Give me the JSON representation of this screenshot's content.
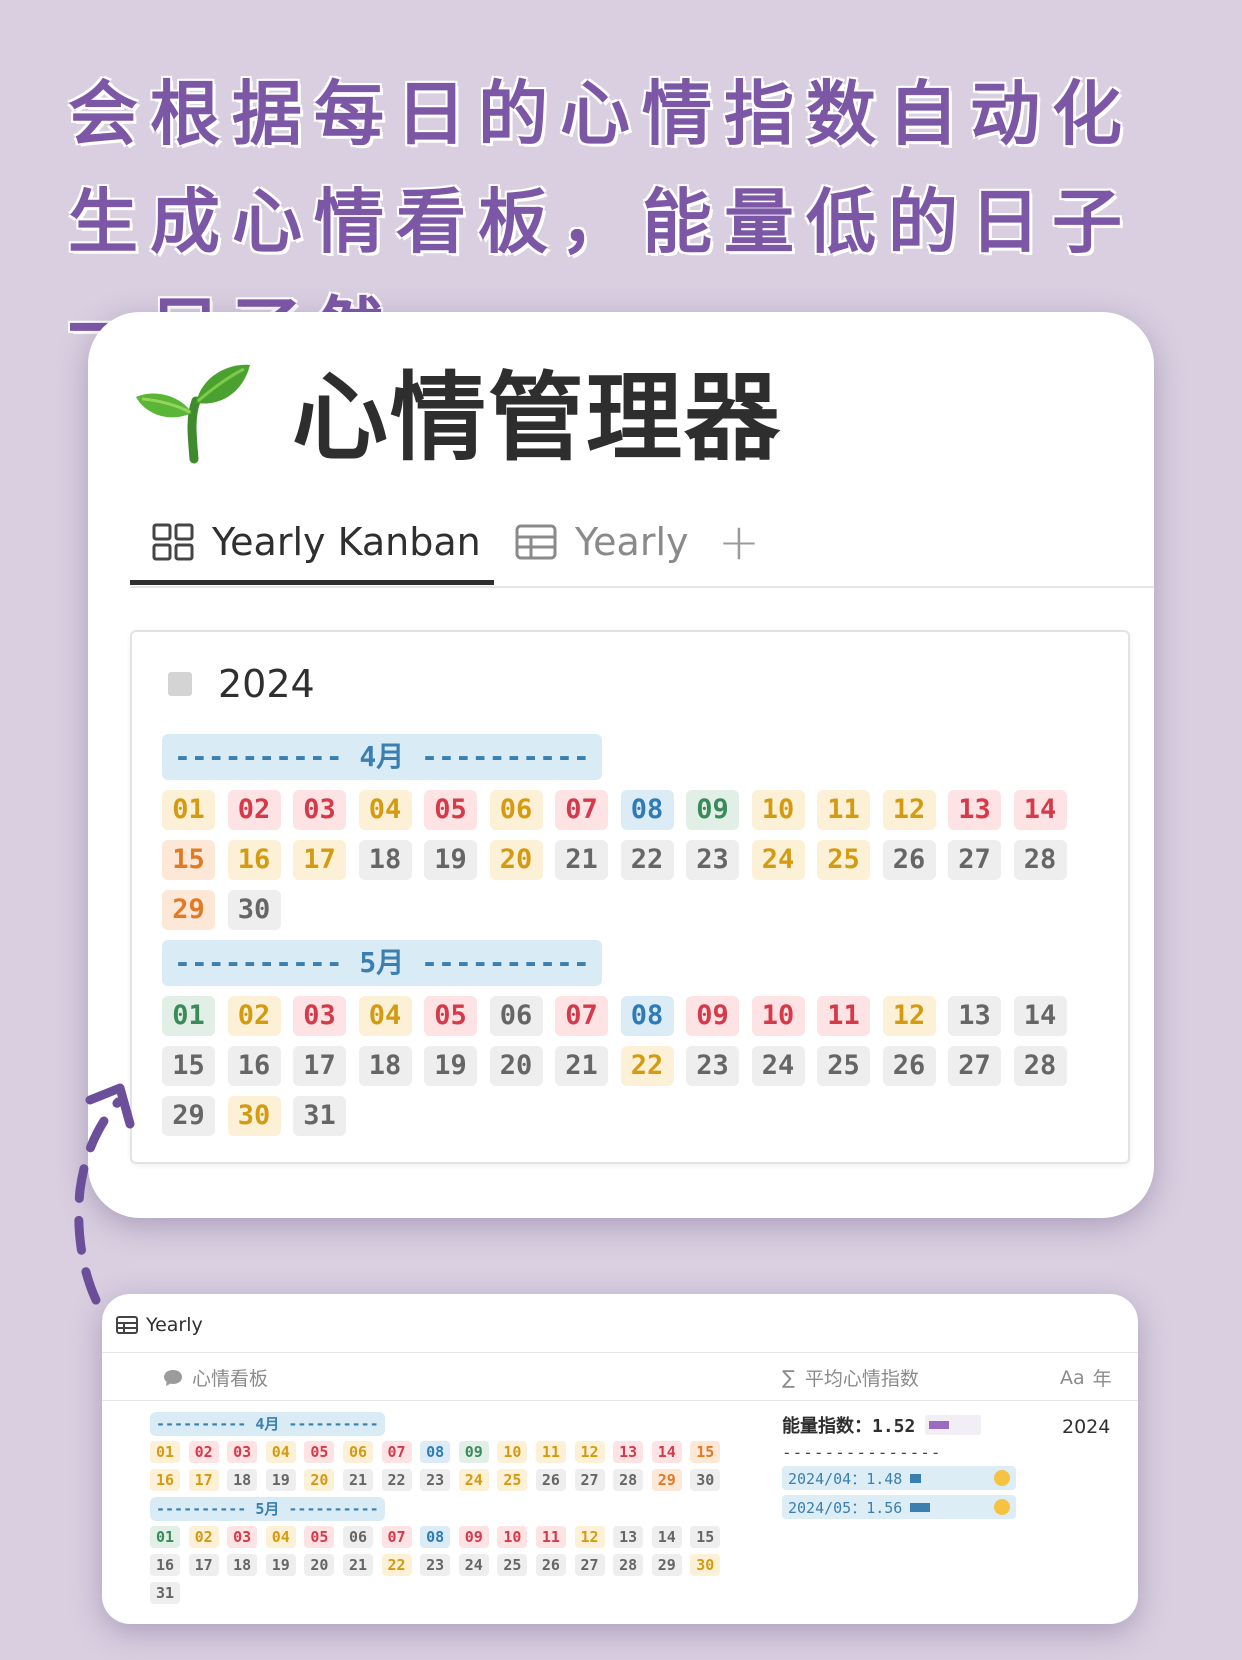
{
  "headline": "会根据每日的心情指数自动化生成心情看板，能量低的日子一目了然。",
  "page": {
    "title": "心情管理器",
    "icon": "sprout-icon"
  },
  "tabs": [
    {
      "label": "Yearly Kanban",
      "icon": "board-icon",
      "active": true
    },
    {
      "label": "Yearly",
      "icon": "table-icon",
      "active": false
    },
    {
      "label": "+",
      "icon": "plus-icon",
      "active": false
    }
  ],
  "kanban": {
    "group_title": "2024",
    "months": [
      {
        "label": "---------- 4月 ----------",
        "days": [
          {
            "d": "01",
            "c": "yel"
          },
          {
            "d": "02",
            "c": "red"
          },
          {
            "d": "03",
            "c": "red"
          },
          {
            "d": "04",
            "c": "yel"
          },
          {
            "d": "05",
            "c": "red"
          },
          {
            "d": "06",
            "c": "yel"
          },
          {
            "d": "07",
            "c": "red"
          },
          {
            "d": "08",
            "c": "blu"
          },
          {
            "d": "09",
            "c": "grn"
          },
          {
            "d": "10",
            "c": "yel"
          },
          {
            "d": "11",
            "c": "yel"
          },
          {
            "d": "12",
            "c": "yel"
          },
          {
            "d": "13",
            "c": "red"
          },
          {
            "d": "14",
            "c": "red"
          },
          {
            "d": "15",
            "c": "ora"
          },
          {
            "d": "16",
            "c": "yel"
          },
          {
            "d": "17",
            "c": "yel"
          },
          {
            "d": "18",
            "c": "gry"
          },
          {
            "d": "19",
            "c": "gry"
          },
          {
            "d": "20",
            "c": "yel"
          },
          {
            "d": "21",
            "c": "gry"
          },
          {
            "d": "22",
            "c": "gry"
          },
          {
            "d": "23",
            "c": "gry"
          },
          {
            "d": "24",
            "c": "yel"
          },
          {
            "d": "25",
            "c": "yel"
          },
          {
            "d": "26",
            "c": "gry"
          },
          {
            "d": "27",
            "c": "gry"
          },
          {
            "d": "28",
            "c": "gry"
          },
          {
            "d": "29",
            "c": "ora"
          },
          {
            "d": "30",
            "c": "gry"
          }
        ]
      },
      {
        "label": "---------- 5月 ----------",
        "days": [
          {
            "d": "01",
            "c": "grn"
          },
          {
            "d": "02",
            "c": "yel"
          },
          {
            "d": "03",
            "c": "red"
          },
          {
            "d": "04",
            "c": "yel"
          },
          {
            "d": "05",
            "c": "red"
          },
          {
            "d": "06",
            "c": "gry"
          },
          {
            "d": "07",
            "c": "red"
          },
          {
            "d": "08",
            "c": "blu"
          },
          {
            "d": "09",
            "c": "red"
          },
          {
            "d": "10",
            "c": "red"
          },
          {
            "d": "11",
            "c": "red"
          },
          {
            "d": "12",
            "c": "yel"
          },
          {
            "d": "13",
            "c": "gry"
          },
          {
            "d": "14",
            "c": "gry"
          },
          {
            "d": "15",
            "c": "gry"
          },
          {
            "d": "16",
            "c": "gry"
          },
          {
            "d": "17",
            "c": "gry"
          },
          {
            "d": "18",
            "c": "gry"
          },
          {
            "d": "19",
            "c": "gry"
          },
          {
            "d": "20",
            "c": "gry"
          },
          {
            "d": "21",
            "c": "gry"
          },
          {
            "d": "22",
            "c": "yel"
          },
          {
            "d": "23",
            "c": "gry"
          },
          {
            "d": "24",
            "c": "gry"
          },
          {
            "d": "25",
            "c": "gry"
          },
          {
            "d": "26",
            "c": "gry"
          },
          {
            "d": "27",
            "c": "gry"
          },
          {
            "d": "28",
            "c": "gry"
          },
          {
            "d": "29",
            "c": "gry"
          },
          {
            "d": "30",
            "c": "yel"
          },
          {
            "d": "31",
            "c": "gry"
          }
        ]
      }
    ]
  },
  "table": {
    "title": "Yearly",
    "columns": [
      {
        "label": "心情看板",
        "icon": "comment-icon"
      },
      {
        "label": "平均心情指数",
        "icon": "sigma-icon"
      },
      {
        "label": "年",
        "prefix": "Aa",
        "icon": "text-icon"
      }
    ],
    "row": {
      "energy_label": "能量指数：1.52",
      "energy_fraction": 0.5,
      "divider": "---------------",
      "months": [
        {
          "label": "2024/04：1.48",
          "fraction": 0.18,
          "emoji": "crying-face-icon"
        },
        {
          "label": "2024/05：1.56",
          "fraction": 0.33,
          "emoji": "sad-face-icon"
        }
      ],
      "year": "2024"
    }
  },
  "colors": {
    "background": "#d9cfe0",
    "headline": "#7c57a6",
    "red": "#d6394a",
    "yellow": "#d49a12",
    "orange": "#e07a24",
    "gray": "#666666",
    "blue": "#2e7bb5",
    "green": "#3a8a5a",
    "energy_bar": "#9a6cc0"
  }
}
